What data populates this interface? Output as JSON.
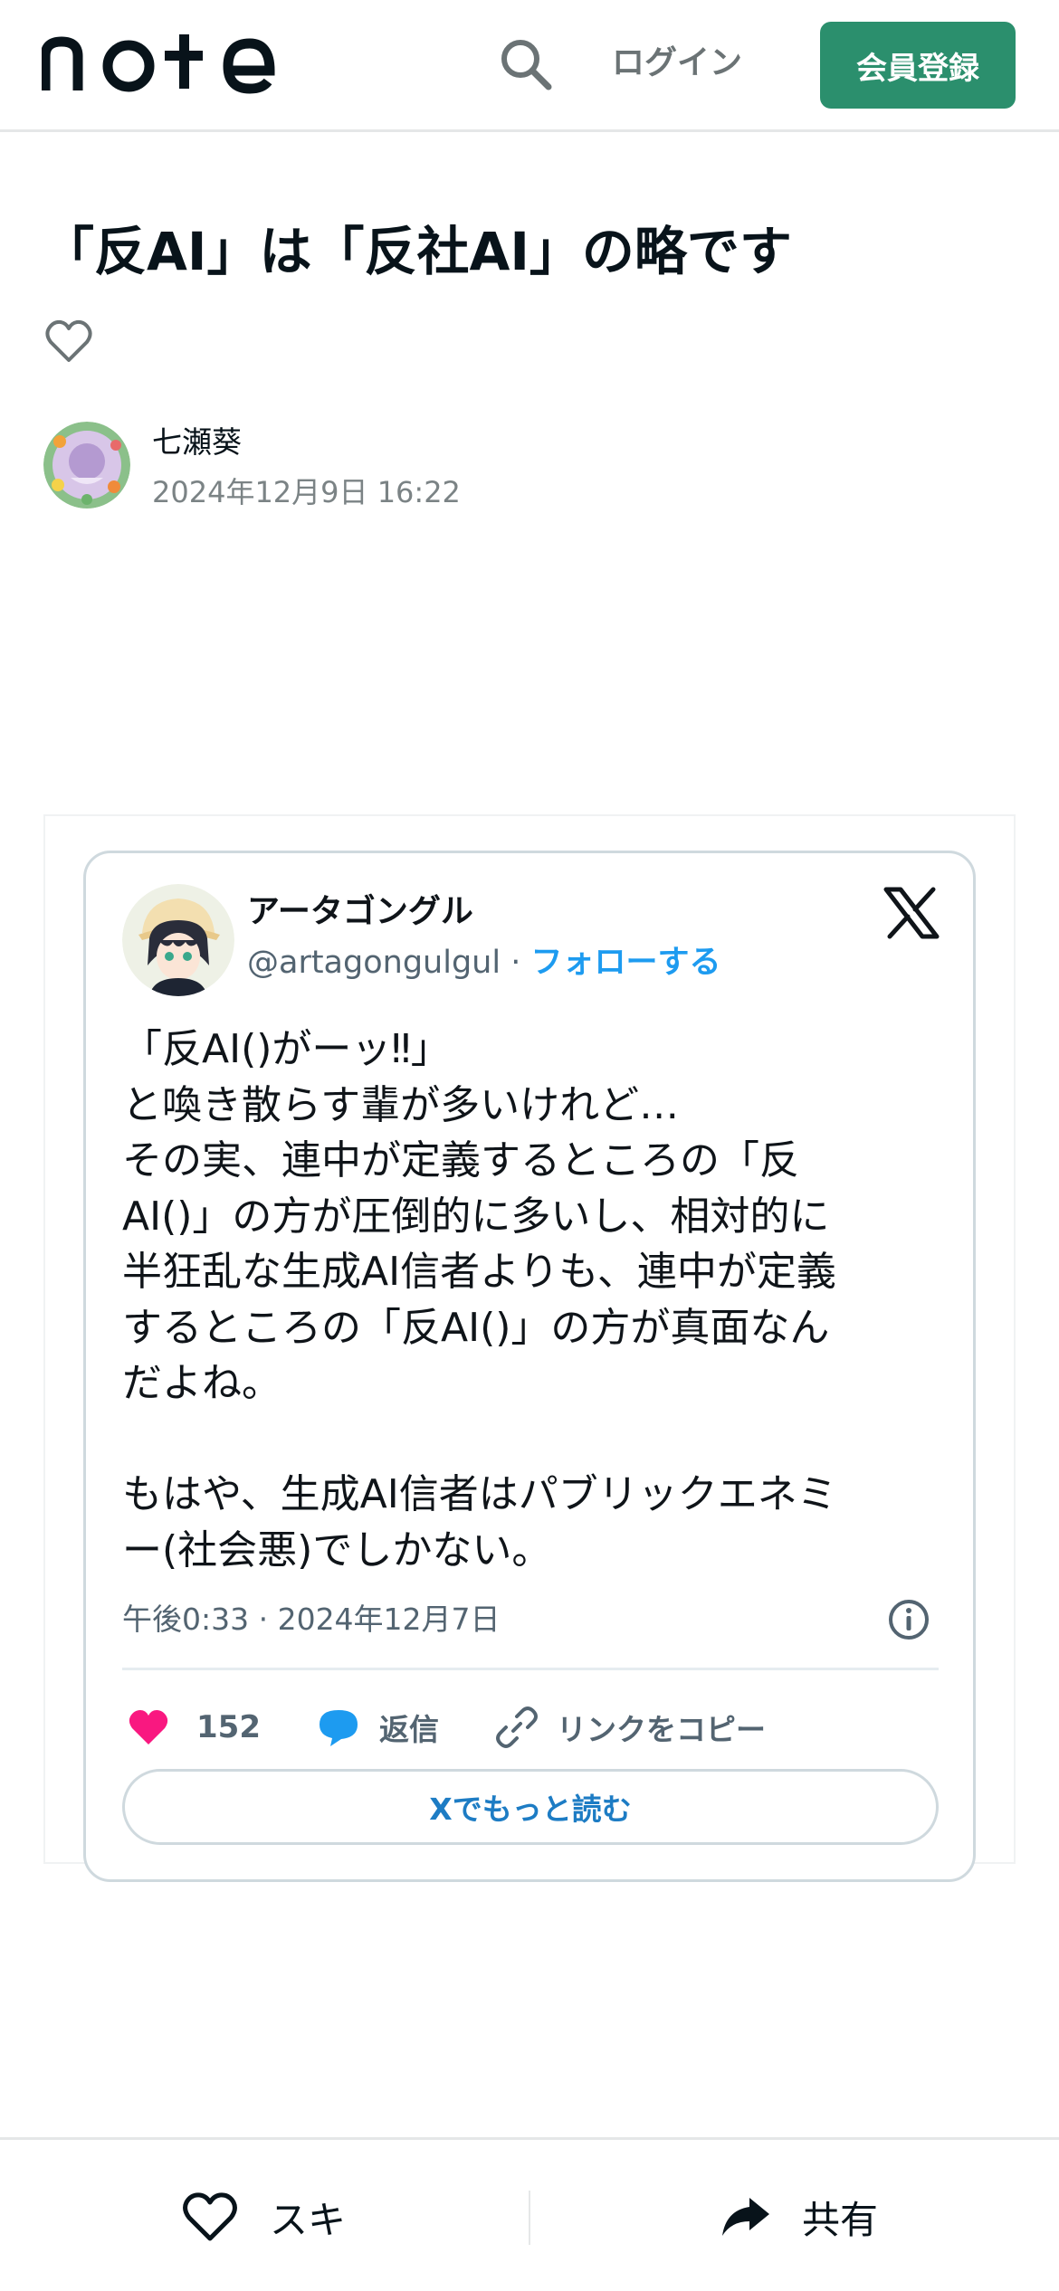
{
  "header": {
    "logo_text": "note",
    "login_label": "ログイン",
    "signup_label": "会員登録",
    "accent_color": "#2b8f6d"
  },
  "article": {
    "title": "「反AI」は「反社AI」の略です",
    "author_name": "七瀬葵",
    "date": "2024年12月9日 16:22"
  },
  "tweet": {
    "display_name": "アータゴングル",
    "handle": "@artagongulgul",
    "separator": " · ",
    "follow_label": "フォローする",
    "text": "「反AI()がーッ‼」\nと喚き散らす輩が多いけれど…\nその実、連中が定義するところの「反\nAI()」の方が圧倒的に多いし、相対的に\n半狂乱な生成AI信者よりも、連中が定義\nするところの「反AI()」の方が真面なん\nだよね。\n\nもはや、生成AI信者はパブリックエネミ\nー(社会悪)でしかない。",
    "timestamp": "午後0:33 · 2024年12月7日",
    "like_count": "152",
    "reply_label": "返信",
    "copy_link_label": "リンクをコピー",
    "read_more_label": "Xでもっと読む",
    "like_color": "#f91880",
    "reply_color": "#1d9bf0"
  },
  "bottom_bar": {
    "like_label": "スキ",
    "share_label": "共有"
  },
  "icons": [
    "search-icon",
    "heart-outline-icon",
    "x-logo-icon",
    "info-icon",
    "heart-filled-icon",
    "speech-bubble-icon",
    "link-icon",
    "share-arrow-icon"
  ]
}
